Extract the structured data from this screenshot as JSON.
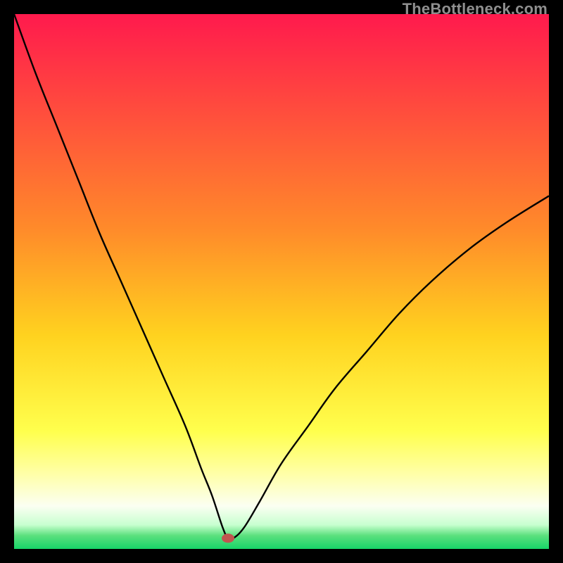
{
  "watermark": "TheBottleneck.com",
  "chart_data": {
    "type": "line",
    "title": "",
    "xlabel": "",
    "ylabel": "",
    "xlim": [
      0,
      100
    ],
    "ylim": [
      0,
      100
    ],
    "optimum_x": 40,
    "marker": {
      "x": 40,
      "y": 2,
      "color": "#c0554f"
    },
    "gradient_stops": [
      {
        "pos": 0.0,
        "color": "#ff1a4d"
      },
      {
        "pos": 0.4,
        "color": "#ff8a2a"
      },
      {
        "pos": 0.6,
        "color": "#ffd21f"
      },
      {
        "pos": 0.78,
        "color": "#ffff4d"
      },
      {
        "pos": 0.86,
        "color": "#ffffa8"
      },
      {
        "pos": 0.92,
        "color": "#fbfff2"
      },
      {
        "pos": 0.955,
        "color": "#c8ffd0"
      },
      {
        "pos": 0.975,
        "color": "#5be07e"
      },
      {
        "pos": 1.0,
        "color": "#17d468"
      }
    ],
    "series": [
      {
        "name": "bottleneck-curve",
        "x": [
          0,
          4,
          8,
          12,
          16,
          20,
          24,
          28,
          32,
          35,
          37,
          39,
          40,
          41,
          43,
          46,
          50,
          55,
          60,
          66,
          72,
          78,
          85,
          92,
          100
        ],
        "y": [
          100,
          89,
          79,
          69,
          59,
          50,
          41,
          32,
          23,
          15,
          10,
          4,
          2,
          2,
          4,
          9,
          16,
          23,
          30,
          37,
          44,
          50,
          56,
          61,
          66
        ]
      }
    ]
  }
}
